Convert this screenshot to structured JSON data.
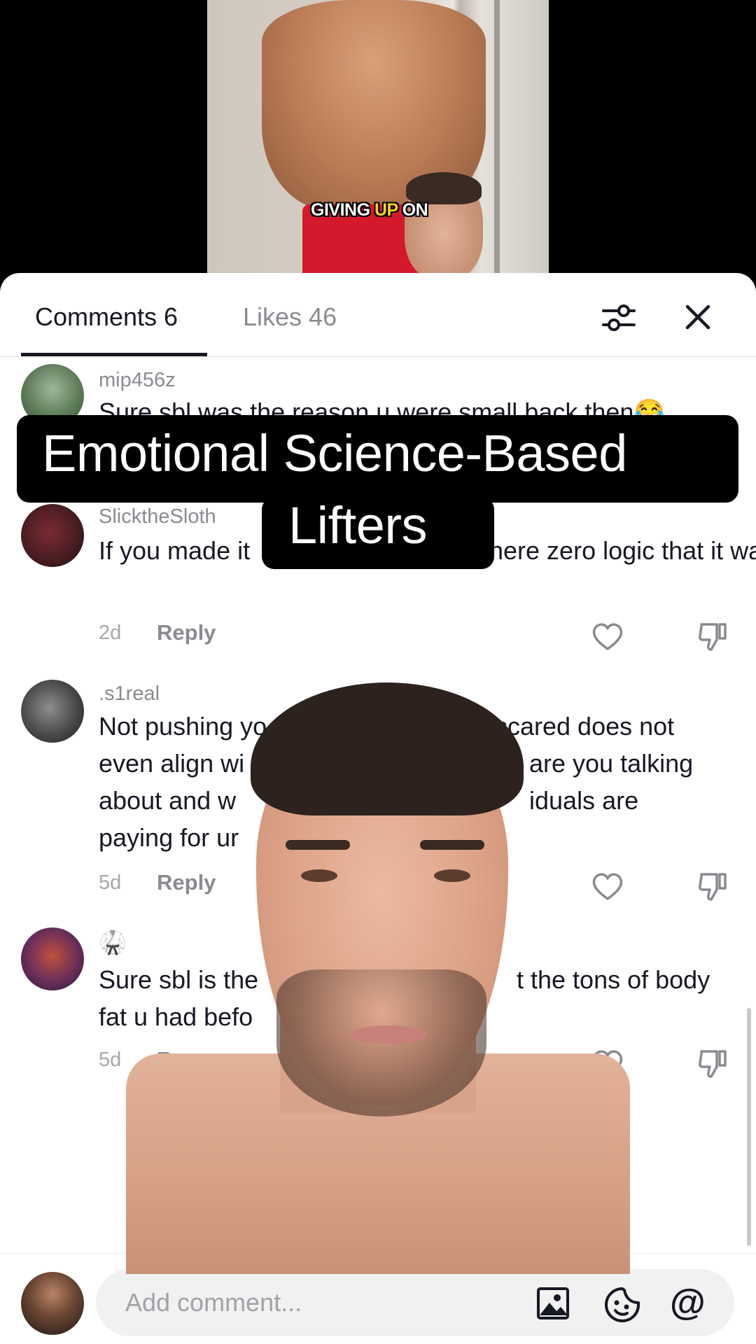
{
  "video": {
    "caption_part1": "GIVING ",
    "caption_highlight": "UP",
    "caption_part2": " ON"
  },
  "tabs": {
    "comments_label": "Comments 6",
    "likes_label": "Likes 46"
  },
  "comments": [
    {
      "username": "mip456z",
      "text": "Sure sbl was the reason u were small back then😂",
      "time": "",
      "reply": ""
    },
    {
      "username": "SlicktheSloth",
      "text": "If you made it",
      "text_cont": "here zero logic that it was cuz of sbl... You just got lean...",
      "time": "2d",
      "reply": "Reply"
    },
    {
      "username": ".s1real",
      "line1a": "Not pushing yo",
      "line1b": "scared does not",
      "line2a": "even align wi",
      "line2b": "are you talking",
      "line3a": "about and w",
      "line3b": "iduals are",
      "line4a": "paying for ur",
      "time": "5d",
      "reply": "Reply"
    },
    {
      "username": "🥋",
      "line1a": "Sure sbl is the",
      "line1b": "t the tons of body",
      "line2a": "fat u had befo",
      "time": "5d",
      "reply": "Rep"
    }
  ],
  "composer": {
    "placeholder": "Add comment..."
  },
  "overlay": {
    "title_line1": "Emotional Science-Based",
    "title_line2": "Lifters"
  },
  "colors": {
    "caption_highlight": "#ffd21f",
    "primary_text": "#161823",
    "secondary_text": "#8a8b91",
    "shorts_red": "#d5192c"
  },
  "icons": {
    "filter": "sliders-icon",
    "close": "close-icon",
    "like": "heart-icon",
    "dislike": "dislike-icon",
    "image": "image-icon",
    "sticker": "sticker-icon",
    "mention": "at-icon"
  }
}
